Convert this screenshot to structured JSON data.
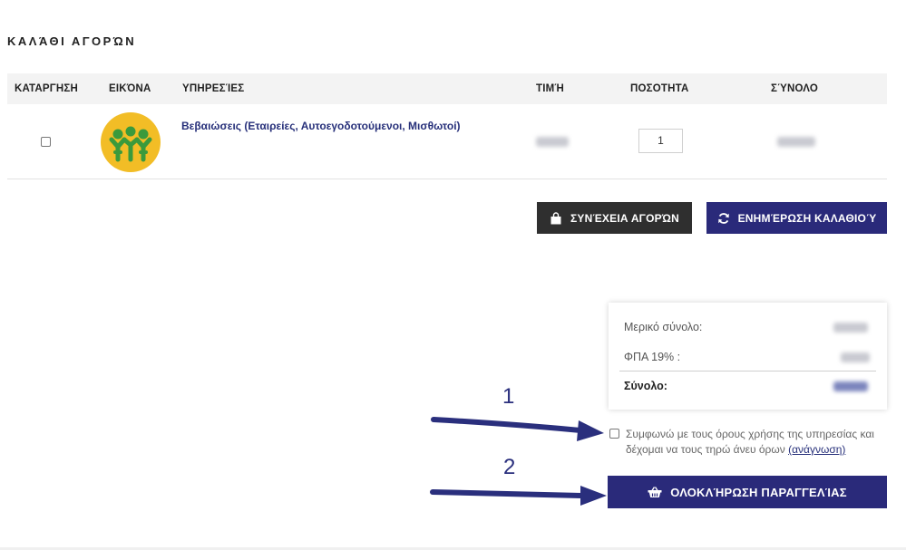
{
  "page": {
    "title": "ΚΑΛΆΘΙ ΑΓΟΡΏΝ"
  },
  "table": {
    "headers": {
      "remove": "ΚΑΤΑΡΓΗΣΗ",
      "image": "ΕΙΚΌΝΑ",
      "services": "ΥΠΗΡΕΣΊΕΣ",
      "price": "ΤΙΜΉ",
      "quantity": "ΠΟΣΟΤΗΤΑ",
      "total": "ΣΎΝΟΛΟ"
    },
    "rows": [
      {
        "product": "Βεβαιώσεις (Εταιρείες, Αυτοεγοδοτούμενοι, Μισθωτοί)",
        "quantity": "1",
        "logo_colors": {
          "background": "#f2bd26",
          "figures": "#3a9a3c"
        }
      }
    ]
  },
  "buttons": {
    "continue_shopping": "ΣΥΝΈΧΕΙΑ ΑΓΟΡΏΝ",
    "update_cart": "ΕΝΗΜΈΡΩΣΗ ΚΑΛΑΘΙΟΎ",
    "complete_order": "ΟΛΟΚΛΉΡΩΣΗ ΠΑΡΑΓΓΕΛΊΑΣ"
  },
  "summary": {
    "subtotal_label": "Μερικό σύνολο:",
    "vat_label": "ΦΠΑ 19% :",
    "total_label": "Σύνολο:"
  },
  "terms": {
    "text": "Συμφωνώ με τους όρους χρήσης της υπηρεσίας και δέχομαι να τους τηρώ άνευ όρων",
    "link_text": "(ανάγνωση)"
  },
  "annotations": {
    "step1": "1",
    "step2": "2"
  },
  "icons": {
    "continue_shopping": "shopping-bag-icon",
    "update_cart": "refresh-icon",
    "complete_order": "basket-icon"
  },
  "colors": {
    "accent": "#2a2a7a",
    "dark_button": "#2f2f2f",
    "link": "#27307a",
    "arrow": "#2a2f7d"
  }
}
